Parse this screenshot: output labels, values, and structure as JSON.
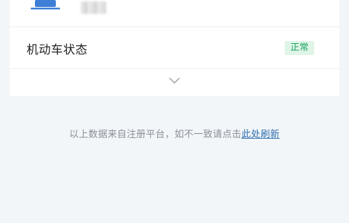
{
  "vehicle": {
    "icon": "car-icon",
    "plate_text": ""
  },
  "status": {
    "label": "机动车状态",
    "badge": "正常",
    "badge_color": "#1fa463"
  },
  "expand": {
    "icon": "chevron-down-icon"
  },
  "footer": {
    "text": "以上数据来自注册平台，如不一致请点击",
    "link_label": "此处刷新",
    "link_color": "#2f6fb0"
  }
}
